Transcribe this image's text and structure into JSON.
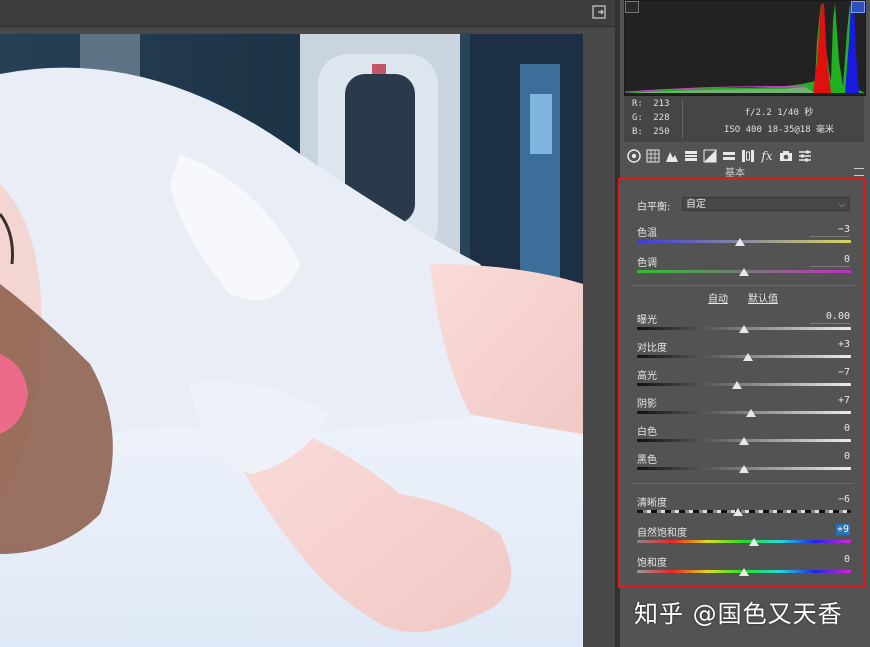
{
  "histogram_panel": {
    "rgb": [
      {
        "label": "R",
        "value": "213"
      },
      {
        "label": "G",
        "value": "228"
      },
      {
        "label": "B",
        "value": "250"
      }
    ],
    "exif_line1": "f/2.2   1/40 秒",
    "exif_line2": "ISO 400   18-35@18 毫米"
  },
  "section": {
    "title": "基本"
  },
  "basic": {
    "white_balance_label": "白平衡:",
    "white_balance_value": "自定",
    "auto_link": "自动",
    "default_link": "默认值",
    "sliders": [
      {
        "id": "temperature",
        "label": "色温",
        "value": "−3",
        "fraction": 0.48
      },
      {
        "id": "tint",
        "label": "色调",
        "value": "0",
        "fraction": 0.5
      },
      {
        "id": "exposure",
        "label": "曝光",
        "value": "0.00",
        "fraction": 0.5
      },
      {
        "id": "contrast",
        "label": "对比度",
        "value": "+3",
        "fraction": 0.52
      },
      {
        "id": "highlights",
        "label": "高光",
        "value": "−7",
        "fraction": 0.465
      },
      {
        "id": "shadows",
        "label": "阴影",
        "value": "+7",
        "fraction": 0.535
      },
      {
        "id": "whites",
        "label": "白色",
        "value": "0",
        "fraction": 0.5
      },
      {
        "id": "blacks",
        "label": "黑色",
        "value": "0",
        "fraction": 0.5
      },
      {
        "id": "clarity",
        "label": "清晰度",
        "value": "−6",
        "fraction": 0.47
      },
      {
        "id": "vibrance",
        "label": "自然饱和度",
        "value": "+9",
        "fraction": 0.545
      },
      {
        "id": "saturation",
        "label": "饱和度",
        "value": "0",
        "fraction": 0.5
      }
    ]
  },
  "watermark": "知乎 @国色又天香",
  "colors": {
    "frame_red": "#e01a1a",
    "panel_bg": "#535353",
    "highlight_blue": "#2b6fb5"
  },
  "icons": [
    "fit-to-screen-icon",
    "aperture-icon",
    "tone-curve-icon",
    "detail-icon",
    "hsl-icon",
    "split-toning-icon",
    "lens-icon",
    "transform-icon",
    "effects-icon",
    "camera-calibration-icon",
    "presets-icon"
  ]
}
